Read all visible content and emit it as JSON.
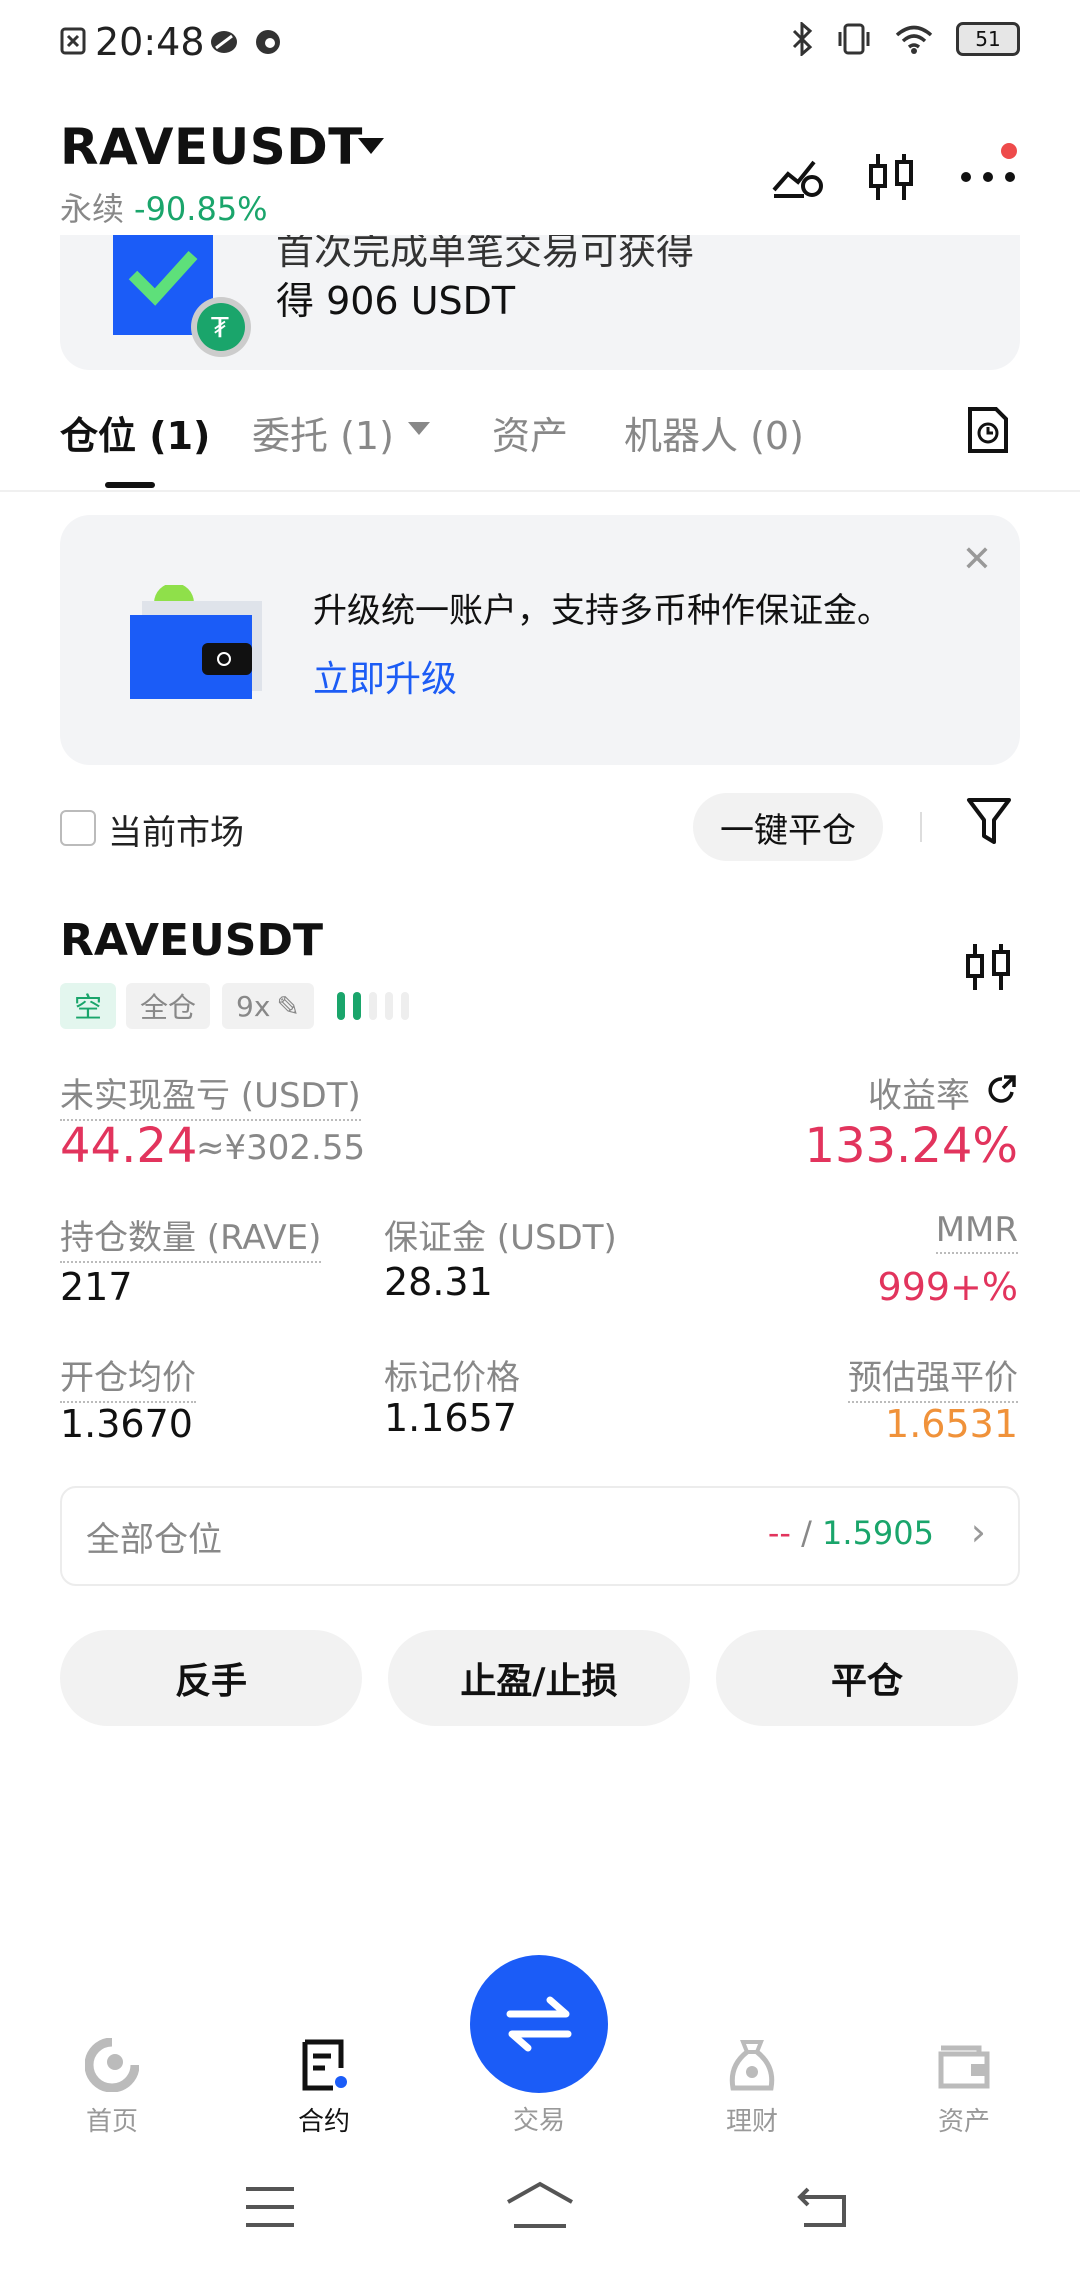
{
  "status_bar": {
    "time": "20:48",
    "battery": "51"
  },
  "header": {
    "pair": "RAVEUSDT",
    "type": "永续",
    "change": "-90.85%"
  },
  "banner": {
    "partial_text": "首次完成单笔交易可获得",
    "reward_text": "得 906 USDT"
  },
  "tabs": [
    {
      "label": "仓位 (1)"
    },
    {
      "label": "委托 (1)"
    },
    {
      "label": "资产"
    },
    {
      "label": "机器人 (0)"
    }
  ],
  "upgrade": {
    "message": "升级统一账户，支持多币种作保证金。",
    "link": "立即升级"
  },
  "filters": {
    "current_market": "当前市场",
    "close_all": "一键平仓"
  },
  "position": {
    "pair": "RAVEUSDT",
    "tags": {
      "side": "空",
      "margin": "全仓",
      "leverage": "9x"
    },
    "unrealized_label": "未实现盈亏 (USDT)",
    "unrealized_value": "44.24",
    "unrealized_cny": "≈¥302.55",
    "roe_label": "收益率",
    "roe_value": "133.24%",
    "qty_label": "持仓数量 (RAVE)",
    "qty_value": "217",
    "margin_label": "保证金 (USDT)",
    "margin_value": "28.31",
    "mmr_label": "MMR",
    "mmr_value": "999+%",
    "entry_label": "开仓均价",
    "entry_value": "1.3670",
    "mark_label": "标记价格",
    "mark_value": "1.1657",
    "liq_label": "预估强平价",
    "liq_value": "1.6531",
    "all_positions_label": "全部仓位",
    "all_positions_pnl": "--",
    "all_positions_sep": " / ",
    "all_positions_value": "1.5905"
  },
  "actions": {
    "reverse": "反手",
    "tpsl": "止盈/止损",
    "close": "平仓"
  },
  "nav": {
    "home": "首页",
    "contract": "合约",
    "trade": "交易",
    "finance": "理财",
    "assets": "资产"
  },
  "colors": {
    "accent": "#1b5cf7",
    "up": "#1aa56b",
    "down": "#e2345d",
    "warn": "#f0923a"
  }
}
